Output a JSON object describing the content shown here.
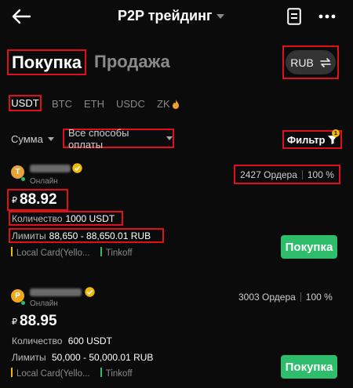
{
  "header": {
    "title": "P2P трейдинг"
  },
  "tabs": {
    "buy": "Покупка",
    "sell": "Продажа"
  },
  "currency_toggle": {
    "label": "RUB"
  },
  "coins": [
    "USDT",
    "BTC",
    "ETH",
    "USDC",
    "ZK"
  ],
  "filters": {
    "amount": "Сумма",
    "payment_methods": "Все способы оплаты",
    "filter": "Фильтр",
    "filter_badge": "1"
  },
  "offers": [
    {
      "avatar_letter": "T",
      "avatar_color": "#e8a23a",
      "status": "Онлайн",
      "orders": "2427 Ордера",
      "completion": "100 %",
      "currency_symbol": "₽",
      "price": "88.92",
      "quantity_label": "Количество",
      "quantity": "1000 USDT",
      "limits_label": "Лимиты",
      "limits": "88,650 - 88,650.01 RUB",
      "pay1": "Local Card(Yello...",
      "pay2": "Tinkoff",
      "button": "Покупка"
    },
    {
      "avatar_letter": "P",
      "avatar_color": "#f0a81a",
      "status": "Онлайн",
      "orders": "3003 Ордера",
      "completion": "100 %",
      "currency_symbol": "₽",
      "price": "88.95",
      "quantity_label": "Количество",
      "quantity": "600 USDT",
      "limits_label": "Лимиты",
      "limits": "50,000 - 50,000.01 RUB",
      "pay1": "Local Card(Yello...",
      "pay2": "Tinkoff",
      "button": "Покупка"
    }
  ],
  "colors": {
    "accent_green": "#2ebd6b",
    "highlight_red": "#e0101a",
    "pay_bar_yellow": "#f0b90b",
    "pay_bar_green": "#2ebd6b"
  }
}
